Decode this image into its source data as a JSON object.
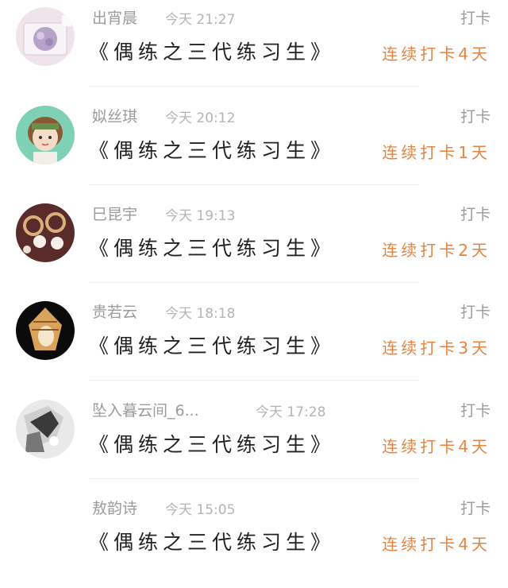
{
  "feed": {
    "items": [
      {
        "name": "出宵晨",
        "time": "今天 21:27",
        "tag": "打卡",
        "course": "《偶练之三代练习生》",
        "streak": "连续打卡4天",
        "avatar": "gift-box-avatar"
      },
      {
        "name": "姒丝琪",
        "time": "今天 20:12",
        "tag": "打卡",
        "course": "《偶练之三代练习生》",
        "streak": "连续打卡1天",
        "avatar": "doll-girl-avatar"
      },
      {
        "name": "巳昆宇",
        "time": "今天 19:13",
        "tag": "打卡",
        "course": "《偶练之三代练习生》",
        "streak": "连续打卡2天",
        "avatar": "pearl-earring-avatar"
      },
      {
        "name": "贵若云",
        "time": "今天 18:18",
        "tag": "打卡",
        "course": "《偶练之三代练习生》",
        "streak": "连续打卡3天",
        "avatar": "seashell-avatar"
      },
      {
        "name": "坠入暮云间_6...",
        "time": "今天 17:28",
        "tag": "打卡",
        "course": "《偶练之三代练习生》",
        "streak": "连续打卡4天",
        "avatar": "anime-sketch-avatar"
      },
      {
        "name": "敖韵诗",
        "time": "今天 15:05",
        "tag": "打卡",
        "course": "《偶练之三代练习生》",
        "streak": "连续打卡4天",
        "avatar": "none"
      }
    ]
  },
  "colors": {
    "name": "#9b9b9b",
    "time": "#b5b5b5",
    "course": "#222222",
    "streak": "#e38442",
    "divider": "#ececec"
  }
}
